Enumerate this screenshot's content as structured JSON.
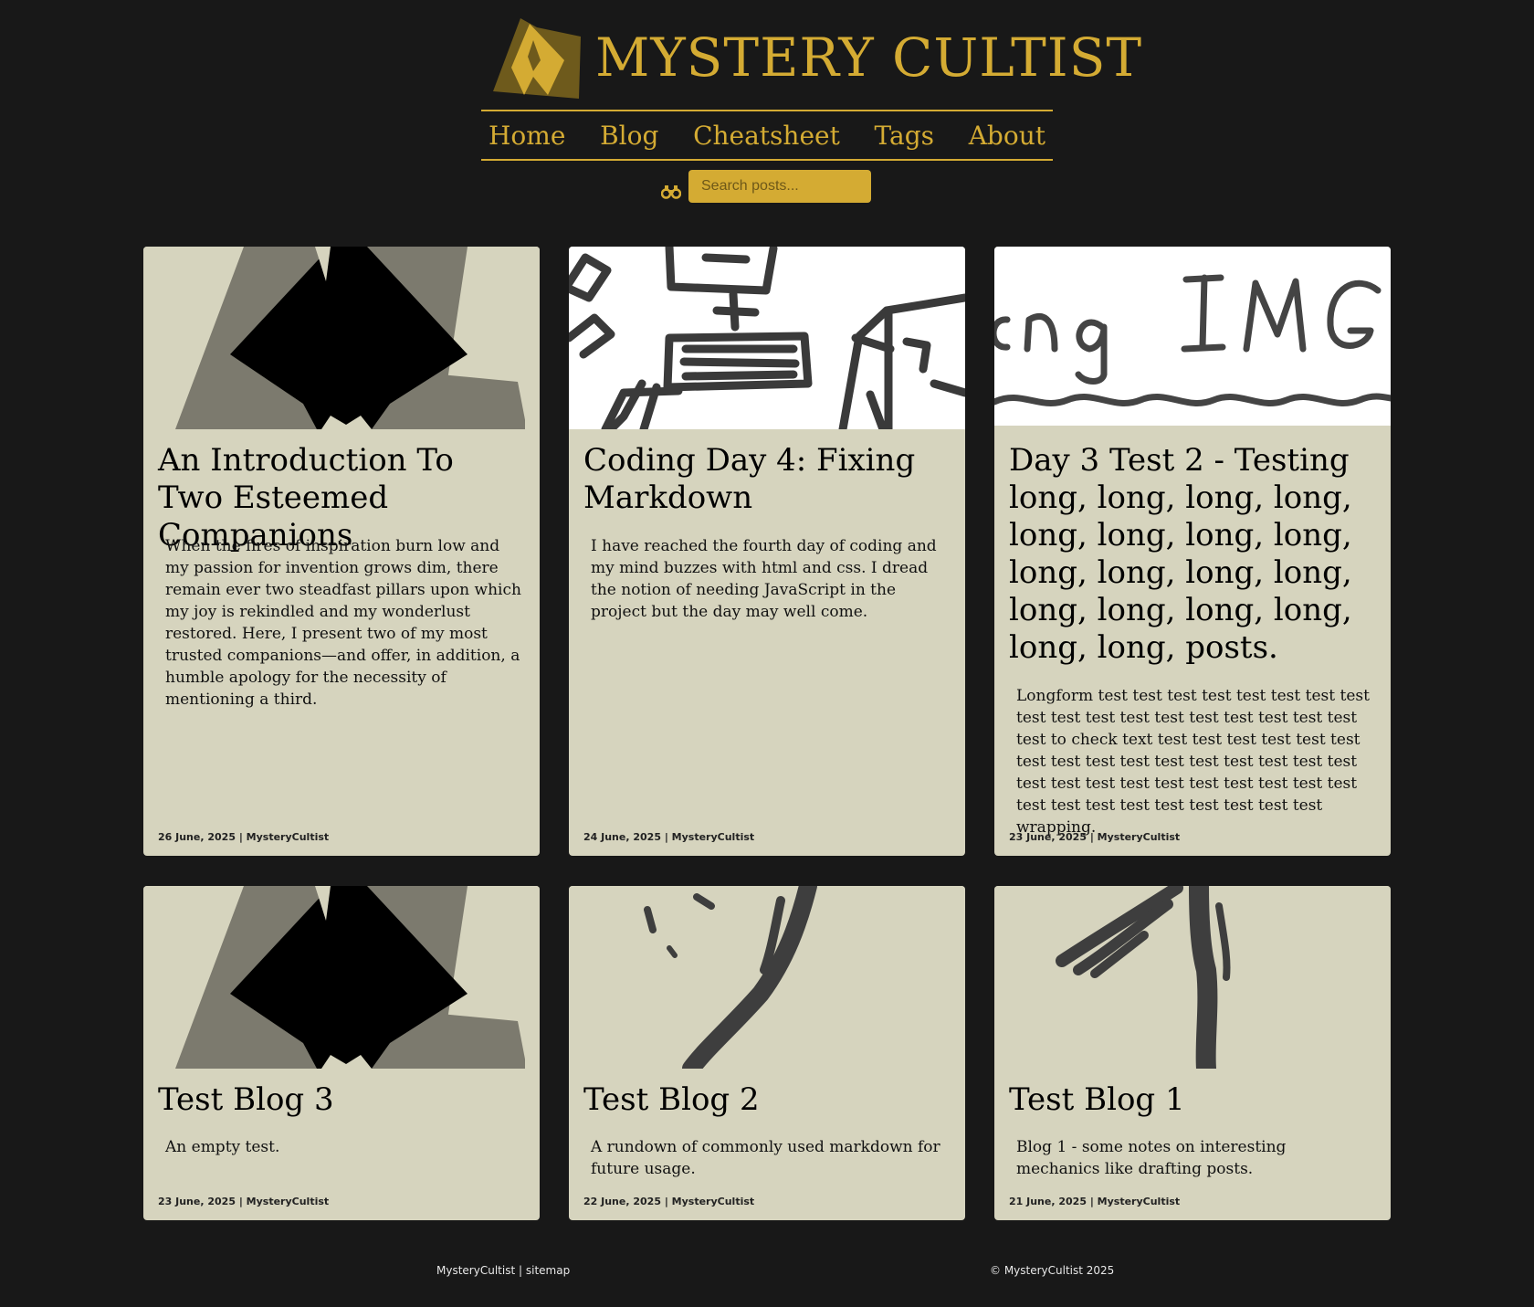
{
  "site": {
    "brand": "MYSTERY CULTIST",
    "colors": {
      "background": "#181818",
      "accent": "#d4ab33",
      "card": "#d6d4be"
    }
  },
  "nav": {
    "items": [
      {
        "label": "Home"
      },
      {
        "label": "Blog"
      },
      {
        "label": "Cheatsheet"
      },
      {
        "label": "Tags"
      },
      {
        "label": "About"
      }
    ]
  },
  "search": {
    "placeholder": "Search posts...",
    "icon": "binoculars-icon"
  },
  "posts": [
    {
      "title": "An Introduction To Two Esteemed Companions",
      "excerpt": "When the fires of inspiration burn low and my passion for invention grows dim, there remain ever two steadfast pillars upon which my joy is rekindled and my wonderlust restored. Here, I present two of my most trusted companions—and offer, in addition, a humble apology for the necessity of mentioning a third.",
      "date": "26 June, 2025",
      "author": "MysteryCultist",
      "image": "logo-thumbnail"
    },
    {
      "title": "Coding Day 4: Fixing Markdown",
      "excerpt": "I have reached the fourth day of coding and my mind buzzes with html and css. I dread the notion of needing JavaScript in the project but the day may well come.",
      "date": "24 June, 2025",
      "author": "MysteryCultist",
      "image": "sketch-computer-thumbnail"
    },
    {
      "title": "Day 3 Test 2 - Testing long, long, long, long, long, long, long, long, long, long, long, long, long, long, long, long, long, long, posts.",
      "excerpt": "Longform test test test test test test test test test test test test test test test test test test test to check text test test test test test test test test test test test test test test test test test test test test test test test test test test test test test test test test test test test wrapping.",
      "date": "23 June, 2025",
      "author": "MysteryCultist",
      "image": "long-img-sketch-thumbnail"
    },
    {
      "title": "Test Blog 3",
      "excerpt": "An empty test.",
      "date": "23 June, 2025",
      "author": "MysteryCultist",
      "image": "logo-thumbnail"
    },
    {
      "title": "Test Blog 2",
      "excerpt": "A rundown of commonly used markdown for future usage.",
      "date": "22 June, 2025",
      "author": "MysteryCultist",
      "image": "brush-stroke-thumbnail"
    },
    {
      "title": "Test Blog 1",
      "excerpt": "Blog 1 - some notes on interesting mechanics like drafting posts.",
      "date": "21 June, 2025",
      "author": "MysteryCultist",
      "image": "brush-stroke-thumbnail"
    }
  ],
  "footer": {
    "name": "MysteryCultist",
    "separator": "|",
    "sitemap": "sitemap",
    "copyright": "© MysteryCultist 2025"
  }
}
